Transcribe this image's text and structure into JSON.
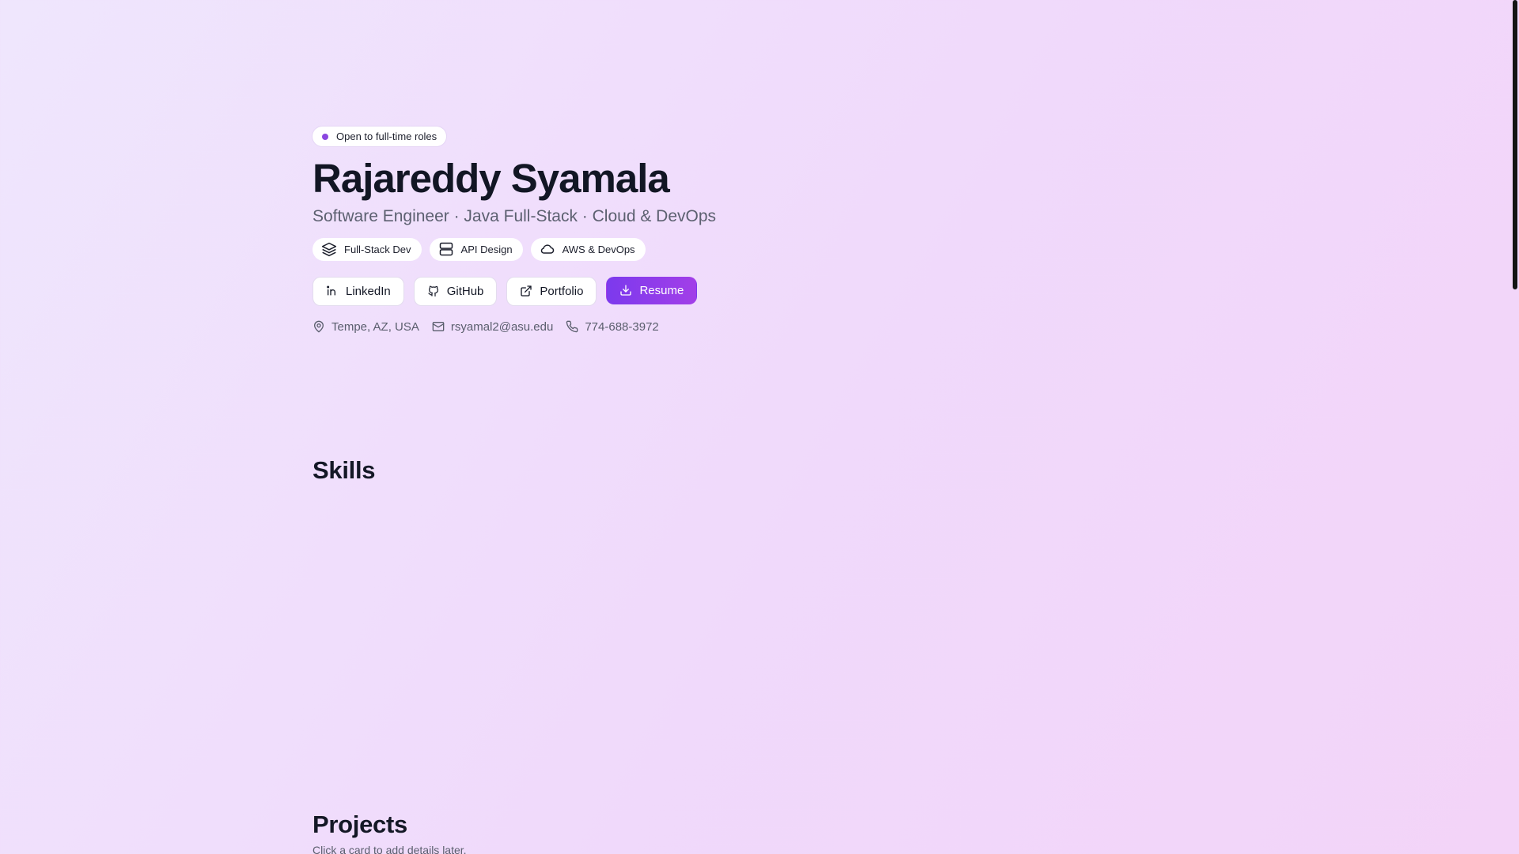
{
  "hero": {
    "status": "Open to full-time roles",
    "name": "Rajareddy Syamala",
    "subtitle": "Software Engineer · Java Full-Stack · Cloud & DevOps",
    "tags": [
      {
        "label": "Full-Stack Dev",
        "icon": "layers-icon"
      },
      {
        "label": "API Design",
        "icon": "server-icon"
      },
      {
        "label": "AWS & DevOps",
        "icon": "cloud-icon"
      }
    ],
    "actions": [
      {
        "label": "LinkedIn",
        "icon": "linkedin-icon"
      },
      {
        "label": "GitHub",
        "icon": "github-icon"
      },
      {
        "label": "Portfolio",
        "icon": "external-link-icon"
      },
      {
        "label": "Resume",
        "icon": "download-icon"
      }
    ],
    "contact": {
      "location": "Tempe, AZ, USA",
      "email": "rsyamal2@asu.edu",
      "phone": "774-688-3972"
    }
  },
  "sections": {
    "skills_title": "Skills",
    "projects_title": "Projects",
    "projects_subtitle": "Click a card to add details later."
  },
  "colors": {
    "accent": "#7c3aed",
    "status_dot": "#8b47e0",
    "text_dark": "#141826",
    "text_muted": "#5a5e6d"
  }
}
